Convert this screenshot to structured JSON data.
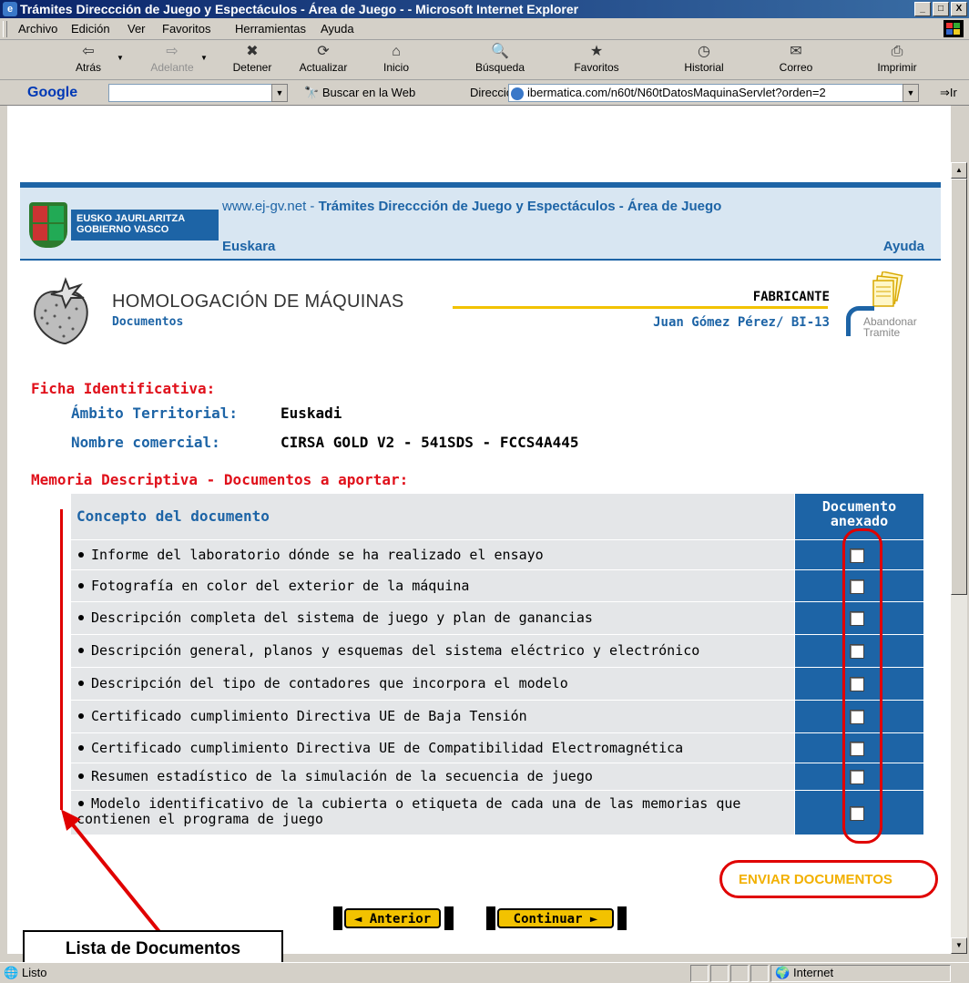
{
  "window": {
    "title": "Trámites Direccción de Juego y Espectáculos - Área de Juego - - Microsoft Internet Explorer",
    "buttons": [
      "_",
      "□",
      "X"
    ]
  },
  "menu": [
    "Archivo",
    "Edición",
    "Ver",
    "Favoritos",
    "Herramientas",
    "Ayuda"
  ],
  "toolbar": [
    {
      "label": "Atrás",
      "icon": "back-icon",
      "glyph": "⇦"
    },
    {
      "label": "Adelante",
      "icon": "forward-icon",
      "glyph": "⇨"
    },
    {
      "label": "Detener",
      "icon": "stop-icon",
      "glyph": "✖"
    },
    {
      "label": "Actualizar",
      "icon": "refresh-icon",
      "glyph": "⟳"
    },
    {
      "label": "Inicio",
      "icon": "home-icon",
      "glyph": "⌂"
    },
    {
      "label": "Búsqueda",
      "icon": "search-icon",
      "glyph": "🔍"
    },
    {
      "label": "Favoritos",
      "icon": "favorites-icon",
      "glyph": "★"
    },
    {
      "label": "Historial",
      "icon": "history-icon",
      "glyph": "◷"
    },
    {
      "label": "Correo",
      "icon": "mail-icon",
      "glyph": "✉"
    },
    {
      "label": "Imprimir",
      "icon": "print-icon",
      "glyph": "⎙"
    }
  ],
  "address": {
    "google": "Google",
    "buscar": "Buscar en la Web",
    "label": "Dirección",
    "url": "ibermatica.com/n60t/N60tDatosMaquinaServlet?orden=2",
    "go": "Ir"
  },
  "header": {
    "site": "www.ej-gv.net",
    "title": "Trámites Direccción de Juego y Espectáculos - Área de Juego",
    "logo_line1": "EUSKO JAURLARITZA",
    "logo_line2": "GOBIERNO VASCO",
    "euskara": "Euskara",
    "ayuda": "Ayuda"
  },
  "heading": {
    "title": "HOMOLOGACIÓN DE MÁQUINAS",
    "subtitle": "Documentos",
    "role": "FABRICANTE",
    "user": "Juan Gómez Pérez/ BI-13",
    "abandon_line1": "Abandonar",
    "abandon_line2": "Tramite"
  },
  "ficha": {
    "heading": "Ficha Identificativa:",
    "ambito_label": "Ámbito Territorial:",
    "ambito_value": "Euskadi",
    "nombre_label": "Nombre comercial:",
    "nombre_value": "CIRSA GOLD V2 - 541SDS - FCCS4A445"
  },
  "memoria": {
    "heading": "Memoria Descriptiva - Documentos a aportar:",
    "col_concept": "Concepto del documento",
    "col_attached": "Documento anexado",
    "rows": [
      "Informe del laboratorio dónde se ha realizado el ensayo",
      "Fotografía en color del exterior de la máquina",
      "Descripción completa del sistema de juego y plan de ganancias",
      "Descripción general, planos y esquemas del sistema eléctrico y electrónico",
      "Descripción del tipo de contadores que incorpora el modelo",
      "Certificado cumplimiento Directiva UE de Baja Tensión",
      "Certificado cumplimiento Directiva UE de Compatibilidad Electromagnética",
      "Resumen estadístico de la simulación de la secuencia de juego",
      "Modelo identificativo de la cubierta o etiqueta de cada una de las memorias que contienen el programa de juego"
    ]
  },
  "actions": {
    "enviar": "ENVIAR DOCUMENTOS",
    "anterior": "◄ Anterior",
    "continuar": "Continuar ►"
  },
  "annotation": {
    "callout": "Lista de Documentos"
  },
  "status": {
    "text": "Listo",
    "zone": "Internet"
  }
}
